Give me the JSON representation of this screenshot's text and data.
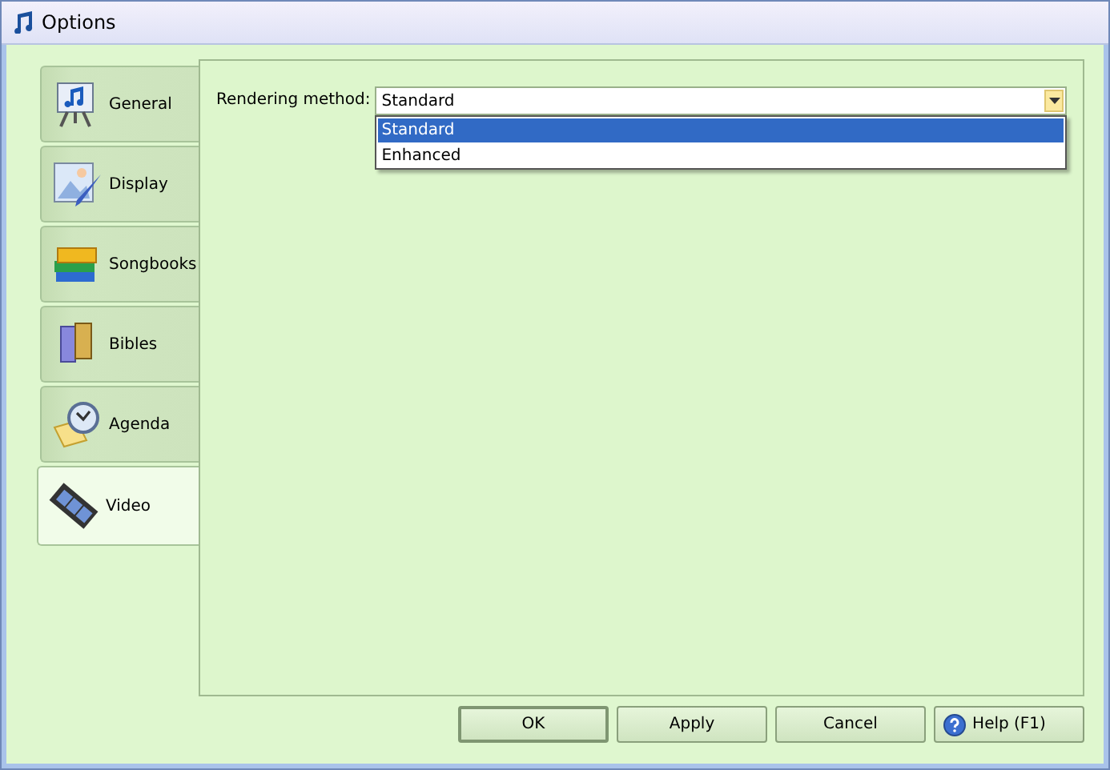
{
  "window": {
    "title": "Options"
  },
  "sidebar": {
    "items": [
      {
        "label": "General",
        "selected": false
      },
      {
        "label": "Display",
        "selected": false
      },
      {
        "label": "Songbooks",
        "selected": false
      },
      {
        "label": "Bibles",
        "selected": false
      },
      {
        "label": "Agenda",
        "selected": false
      },
      {
        "label": "Video",
        "selected": true
      }
    ]
  },
  "rendering_method": {
    "label": "Rendering method:",
    "value": "Standard",
    "expanded": true,
    "options": [
      {
        "label": "Standard",
        "selected": true
      },
      {
        "label": "Enhanced",
        "selected": false
      }
    ]
  },
  "buttons": [
    {
      "label": "OK",
      "kind": "default"
    },
    {
      "label": "Apply",
      "kind": "plain"
    },
    {
      "label": "Cancel",
      "kind": "plain"
    },
    {
      "label": "Help (F1)",
      "kind": "help"
    }
  ]
}
